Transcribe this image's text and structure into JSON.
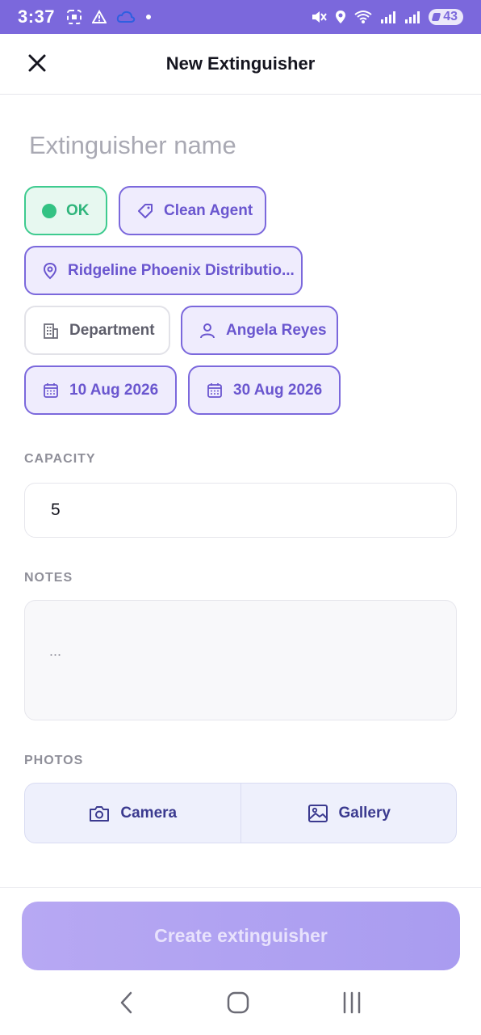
{
  "statusbar": {
    "time": "3:37",
    "battery": "43"
  },
  "header": {
    "title": "New Extinguisher"
  },
  "name_input": {
    "placeholder": "Extinguisher name",
    "value": ""
  },
  "chips": {
    "status": "OK",
    "type": "Clean Agent",
    "location": "Ridgeline Phoenix Distributio...",
    "department": "Department",
    "assignee": "Angela Reyes",
    "date_start": "10 Aug 2026",
    "date_end": "30 Aug 2026"
  },
  "capacity": {
    "label": "CAPACITY",
    "value": "5"
  },
  "notes": {
    "label": "NOTES",
    "placeholder": "..."
  },
  "photos": {
    "label": "PHOTOS",
    "camera": "Camera",
    "gallery": "Gallery"
  },
  "actions": {
    "create": "Create extinguisher"
  },
  "colors": {
    "accent": "#7b68dc",
    "status_ok": "#33c283",
    "chip_bg": "#efecfd"
  }
}
